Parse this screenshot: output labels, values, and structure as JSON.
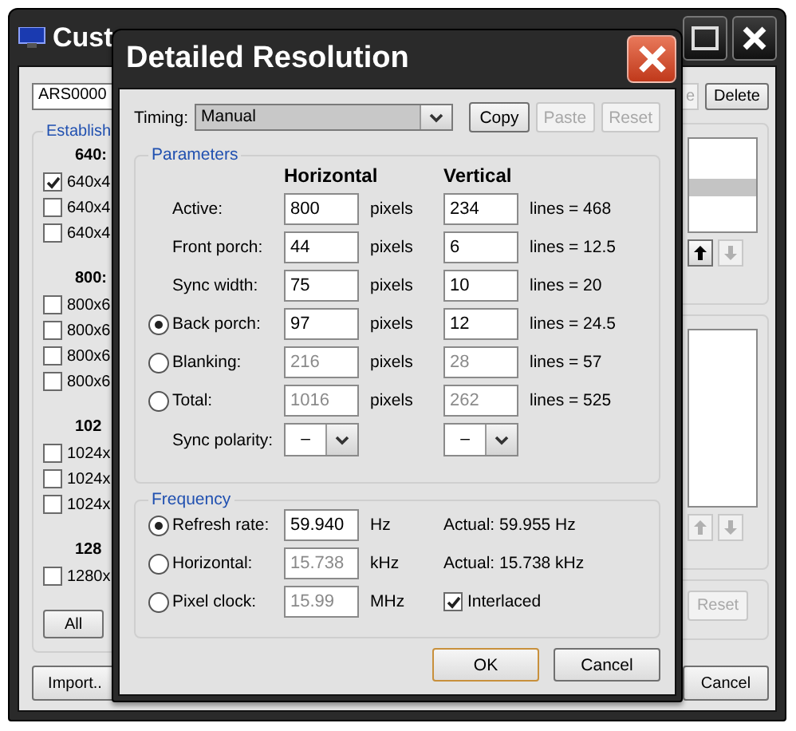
{
  "background_window": {
    "title": "Cust",
    "profile_select": "ARS0000",
    "top_buttons": [
      {
        "label": "e",
        "disabled": true
      },
      {
        "label": "Delete",
        "disabled": false
      }
    ],
    "group_label": "Establish",
    "sections": [
      {
        "header": "640:",
        "items": [
          {
            "label": "640x4",
            "checked": true
          },
          {
            "label": "640x4",
            "checked": false
          },
          {
            "label": "640x4",
            "checked": false
          }
        ]
      },
      {
        "header": "800:",
        "items": [
          {
            "label": "800x6",
            "checked": false
          },
          {
            "label": "800x6",
            "checked": false
          },
          {
            "label": "800x6",
            "checked": false
          },
          {
            "label": "800x6",
            "checked": false
          }
        ]
      },
      {
        "header": "102",
        "items": [
          {
            "label": "1024x",
            "checked": false
          },
          {
            "label": "1024x",
            "checked": false
          },
          {
            "label": "1024x",
            "checked": false
          }
        ]
      },
      {
        "header": "128",
        "items": [
          {
            "label": "1280x",
            "checked": false
          }
        ]
      }
    ],
    "all_button": "All",
    "upper_list": [
      {
        "selected": false
      },
      {
        "selected": true
      },
      {
        "selected": false
      },
      {
        "selected": false
      }
    ],
    "upper_arrows": [
      {
        "kind": "up",
        "disabled": false
      },
      {
        "kind": "down",
        "disabled": true
      }
    ],
    "lower_arrows": [
      {
        "kind": "up",
        "disabled": true
      },
      {
        "kind": "down",
        "disabled": true
      }
    ],
    "reset_button": {
      "label": "Reset",
      "disabled": true
    },
    "import_button": "Import..",
    "cancel_button": "Cancel"
  },
  "dialog": {
    "title": "Detailed Resolution",
    "timing": {
      "label": "Timing:",
      "value": "Manual"
    },
    "actions": [
      {
        "label": "Copy",
        "disabled": false
      },
      {
        "label": "Paste",
        "disabled": true
      },
      {
        "label": "Reset",
        "disabled": true
      }
    ],
    "parameters": {
      "title": "Parameters",
      "col_headers": [
        "Horizontal",
        "Vertical"
      ],
      "rows": [
        {
          "kind": "plain",
          "label": "Active:",
          "h": "800",
          "h_unit": "pixels",
          "v": "234",
          "v_note": "lines = 468",
          "disabled": false
        },
        {
          "kind": "plain",
          "label": "Front porch:",
          "h": "44",
          "h_unit": "pixels",
          "v": "6",
          "v_note": "lines = 12.5",
          "disabled": false
        },
        {
          "kind": "plain",
          "label": "Sync width:",
          "h": "75",
          "h_unit": "pixels",
          "v": "10",
          "v_note": "lines = 20",
          "disabled": false
        },
        {
          "kind": "radio",
          "selected": true,
          "label": "Back porch:",
          "h": "97",
          "h_unit": "pixels",
          "v": "12",
          "v_note": "lines = 24.5",
          "disabled": false
        },
        {
          "kind": "radio",
          "selected": false,
          "label": "Blanking:",
          "h": "216",
          "h_unit": "pixels",
          "v": "28",
          "v_note": "lines = 57",
          "disabled": true
        },
        {
          "kind": "radio",
          "selected": false,
          "label": "Total:",
          "h": "1016",
          "h_unit": "pixels",
          "v": "262",
          "v_note": "lines = 525",
          "disabled": true
        }
      ],
      "sync_polarity": {
        "label": "Sync polarity:",
        "h": "–",
        "v": "–"
      }
    },
    "frequency": {
      "title": "Frequency",
      "rows": [
        {
          "kind": "actual",
          "selected": true,
          "label": "Refresh rate:",
          "value": "59.940",
          "unit": "Hz",
          "disabled": false,
          "note": "Actual: 59.955 Hz"
        },
        {
          "kind": "actual",
          "selected": false,
          "label": "Horizontal:",
          "value": "15.738",
          "unit": "kHz",
          "disabled": true,
          "note": "Actual: 15.738 kHz"
        },
        {
          "kind": "checkbox",
          "selected": false,
          "label": "Pixel clock:",
          "value": "15.99",
          "unit": "MHz",
          "disabled": true,
          "note": "Interlaced",
          "checked": true
        }
      ]
    },
    "buttons": [
      {
        "label": "OK",
        "default": true
      },
      {
        "label": "Cancel",
        "default": false
      }
    ]
  }
}
